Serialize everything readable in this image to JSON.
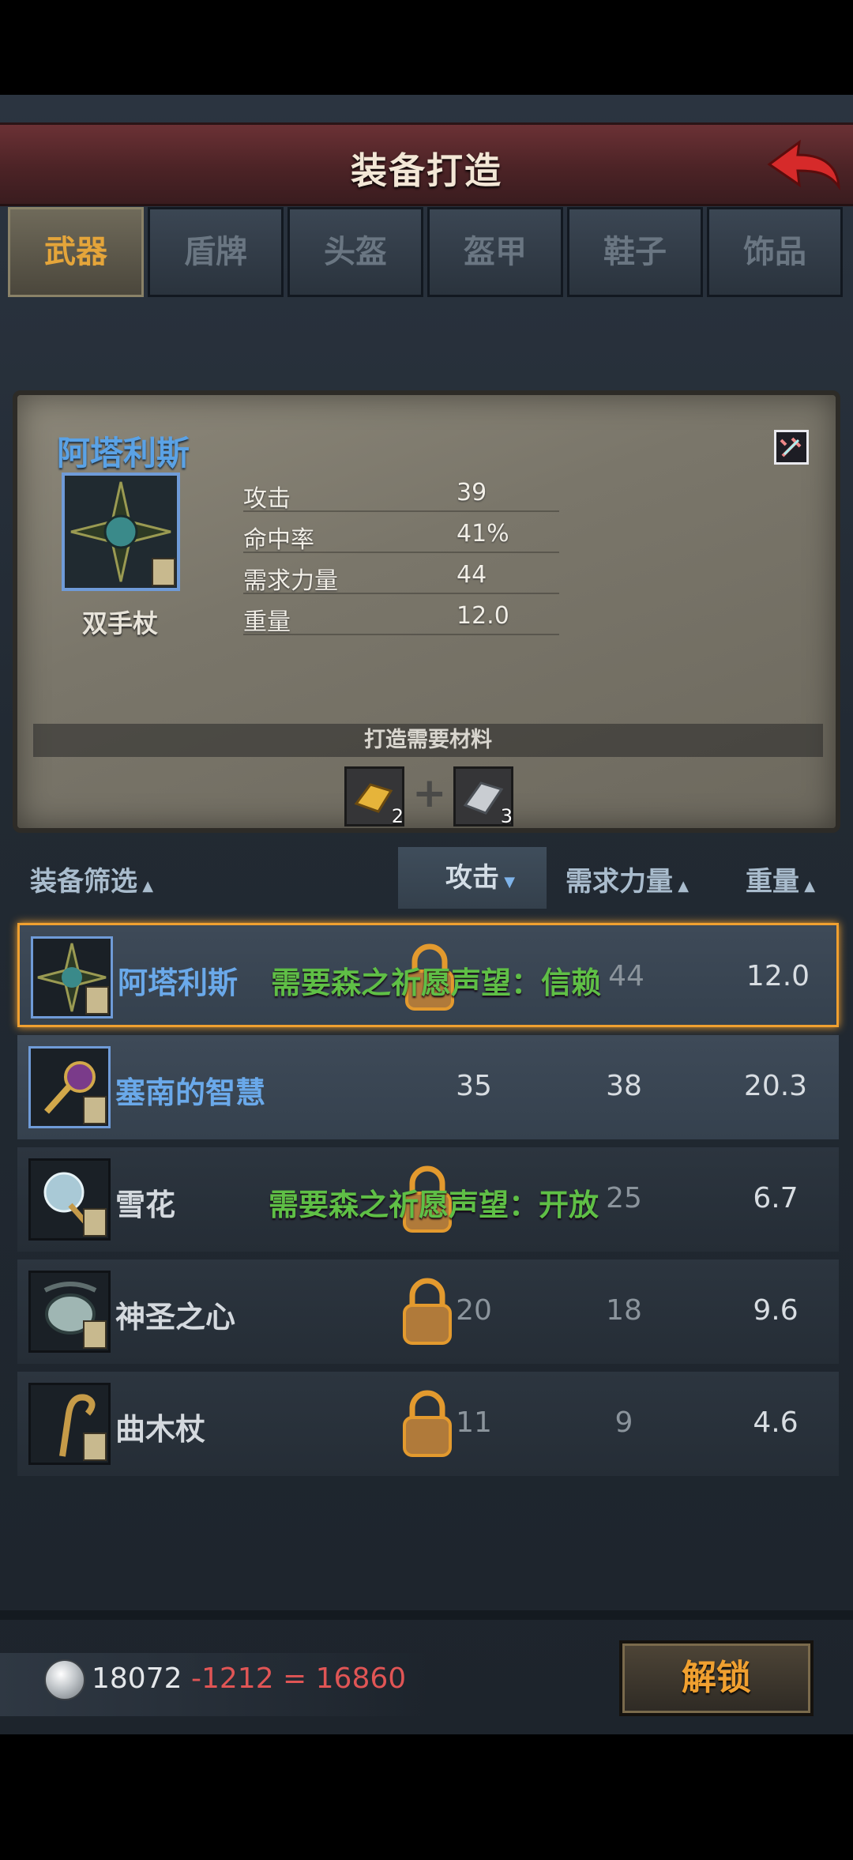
{
  "header": {
    "title": "装备打造"
  },
  "tabs": [
    {
      "label": "武器",
      "active": true
    },
    {
      "label": "盾牌",
      "active": false
    },
    {
      "label": "头盔",
      "active": false
    },
    {
      "label": "盔甲",
      "active": false
    },
    {
      "label": "鞋子",
      "active": false
    },
    {
      "label": "饰品",
      "active": false
    }
  ],
  "detail": {
    "name": "阿塔利斯",
    "type": "双手杖",
    "stats": [
      {
        "label": "攻击",
        "value": "39"
      },
      {
        "label": "命中率",
        "value": "41%"
      },
      {
        "label": "需求力量",
        "value": "44"
      },
      {
        "label": "重量",
        "value": "12.0"
      }
    ],
    "materials_label": "打造需要材料",
    "materials": [
      {
        "icon": "gold-ingot-icon",
        "count": "2"
      },
      {
        "icon": "silver-ingot-icon",
        "count": "3"
      }
    ]
  },
  "filter": {
    "label": "装备筛选",
    "columns": [
      "攻击",
      "需求力量",
      "重量"
    ],
    "sort_column": "攻击"
  },
  "items": [
    {
      "name": "阿塔利斯",
      "attack": "",
      "requirement": "需要森之祈愿声望：信赖",
      "strength": "44",
      "weight": "12.0",
      "locked": true,
      "selected": true
    },
    {
      "name": "塞南的智慧",
      "attack": "35",
      "requirement": "",
      "strength": "38",
      "weight": "20.3",
      "locked": false,
      "selected": false
    },
    {
      "name": "雪花",
      "attack": "",
      "requirement": "需要森之祈愿声望：开放",
      "strength": "25",
      "weight": "6.7",
      "locked": true,
      "selected": false
    },
    {
      "name": "神圣之心",
      "attack": "20",
      "requirement": "",
      "strength": "18",
      "weight": "9.6",
      "locked": true,
      "selected": false
    },
    {
      "name": "曲木杖",
      "attack": "11",
      "requirement": "",
      "strength": "9",
      "weight": "4.6",
      "locked": true,
      "selected": false
    }
  ],
  "footer": {
    "money_base": "18072",
    "money_cost": "-1212",
    "money_result": "= 16860",
    "unlock_label": "解锁"
  },
  "colors": {
    "accent": "#f0a030",
    "blue_name": "#6aa9ea",
    "requirement": "#5fbf46",
    "negative": "#e05555"
  }
}
